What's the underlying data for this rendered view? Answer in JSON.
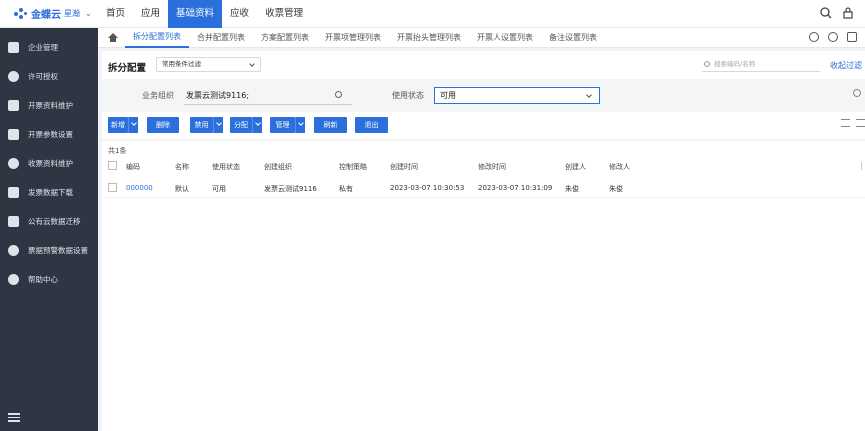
{
  "app": {
    "logo_text": "金蝶云",
    "logo_sub": "星瀚"
  },
  "topnav": [
    "首页",
    "应用",
    "基础资料",
    "应收",
    "收票管理"
  ],
  "sidebar": [
    "企业管理",
    "许可授权",
    "开票资料维护",
    "开票参数设置",
    "收票资料维护",
    "发票数据下载",
    "公有云数据迁移",
    "票据预警数据设置",
    "帮助中心"
  ],
  "tabs": [
    "拆分配置列表",
    "合并配置列表",
    "方案配置列表",
    "开票项管理列表",
    "开票抬头管理列表",
    "开票人设置列表",
    "备注设置列表"
  ],
  "page": {
    "title": "拆分配置",
    "filter_select": "常用条件过滤",
    "search_placeholder": "搜索编码/名称",
    "collapse_label": "收起过滤"
  },
  "filters": {
    "org_label": "业务组织",
    "org_value": "发票云测试9116;",
    "status_label": "使用状态",
    "status_value": "可用"
  },
  "toolbar": {
    "new": "新增",
    "delete": "删除",
    "disable": "禁用",
    "assign": "分配",
    "manage": "管理",
    "refresh": "刷新",
    "exit": "退出"
  },
  "grid": {
    "count": "共1条",
    "headers": [
      "编码",
      "名称",
      "使用状态",
      "创建组织",
      "控制策略",
      "创建时间",
      "修改时间",
      "创建人",
      "修改人"
    ],
    "rows": [
      [
        "000000",
        "默认",
        "可用",
        "发票云测试9116",
        "私有",
        "2023-03-07 10:30:53",
        "2023-03-07 10:31:09",
        "朱俊",
        "朱俊"
      ]
    ]
  },
  "colors": {
    "accent": "#2a6fdb",
    "sidebar_bg": "#2e3543"
  }
}
